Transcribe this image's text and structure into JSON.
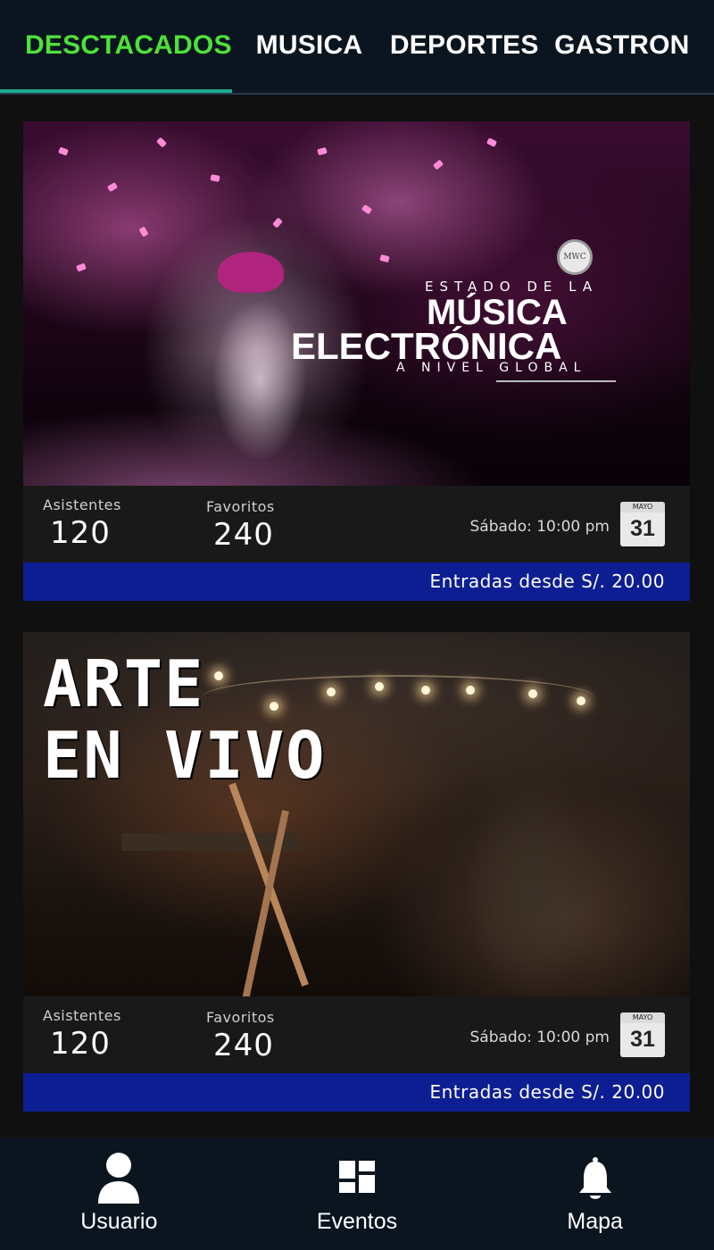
{
  "tabs": [
    {
      "label": "DESCTACADOS"
    },
    {
      "label": "MUSICA"
    },
    {
      "label": "DEPORTES"
    },
    {
      "label": "GASTRON"
    }
  ],
  "colors": {
    "active_tab": "#4fe03a",
    "indicator": "#1fa88f",
    "price_bar": "#0d1e93",
    "nav_bg": "#0b1520"
  },
  "events": [
    {
      "poster_text": {
        "estado": "ESTADO DE LA",
        "musica": "MÚSICA",
        "electronica": "ELECTRÓNICA",
        "nivel": "A NIVEL GLOBAL",
        "logo": "MWC"
      },
      "attendees_label": "Asistentes",
      "attendees": "120",
      "favorites_label": "Favoritos",
      "favorites": "240",
      "schedule": "Sábado: 10:00 pm",
      "cal_month": "MAYO",
      "cal_day": "31",
      "price": "Entradas desde S/. 20.00"
    },
    {
      "poster_text": {
        "line1": "ARTE",
        "line2": "EN VIVO"
      },
      "attendees_label": "Asistentes",
      "attendees": "120",
      "favorites_label": "Favoritos",
      "favorites": "240",
      "schedule": "Sábado: 10:00 pm",
      "cal_month": "MAYO",
      "cal_day": "31",
      "price": "Entradas desde S/. 20.00"
    }
  ],
  "bottom_nav": [
    {
      "label": "Usuario",
      "icon": "user-icon"
    },
    {
      "label": "Eventos",
      "icon": "dashboard-icon"
    },
    {
      "label": "Mapa",
      "icon": "bell-icon"
    }
  ]
}
